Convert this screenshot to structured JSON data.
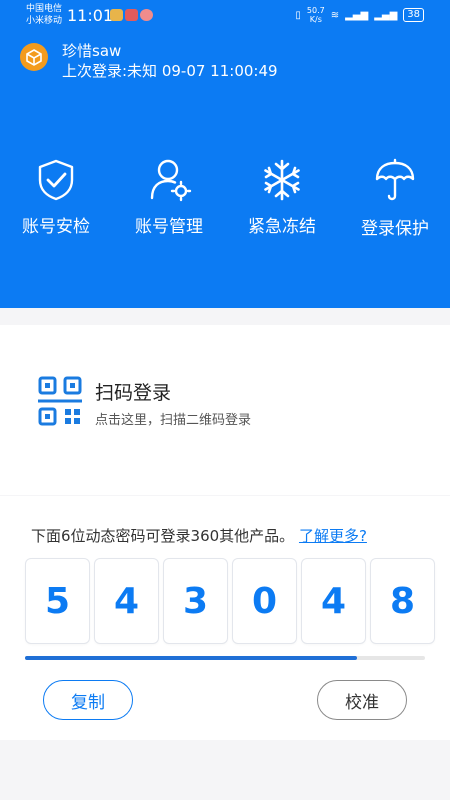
{
  "statusbar": {
    "carrier_line1": "中国电信",
    "carrier_line2": "小米移动",
    "time": "11:01",
    "net_speed_value": "50.7",
    "net_speed_unit": "K/s",
    "battery": "38"
  },
  "user": {
    "name": "珍惜saw",
    "last_login": "上次登录:未知 09-07 11:00:49"
  },
  "actions": [
    {
      "label": "账号安检",
      "icon": "shield-check-icon"
    },
    {
      "label": "账号管理",
      "icon": "user-gear-icon"
    },
    {
      "label": "紧急冻结",
      "icon": "snowflake-icon"
    },
    {
      "label": "登录保护",
      "icon": "umbrella-icon"
    }
  ],
  "scan": {
    "title": "扫码登录",
    "subtitle": "点击这里，扫描二维码登录",
    "icon": "qr-code-icon"
  },
  "otp": {
    "description": "下面6位动态密码可登录360其他产品。",
    "learn_more": "了解更多?",
    "digits": [
      "5",
      "4",
      "3",
      "0",
      "4",
      "8"
    ],
    "progress_fraction": 0.83,
    "copy_label": "复制",
    "calibrate_label": "校准"
  },
  "colors": {
    "brand_blue": "#0c7bf3",
    "avatar_orange": "#f39b1e"
  }
}
